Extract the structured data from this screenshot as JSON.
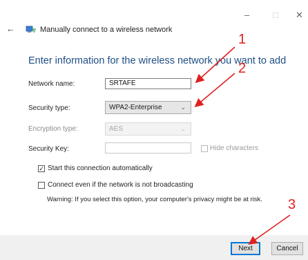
{
  "window": {
    "minimize_glyph": "–",
    "maximize_glyph": "□",
    "close_glyph": "✕",
    "back_glyph": "←",
    "title": "Manually connect to a wireless network"
  },
  "heading": "Enter information for the wireless network you want to add",
  "form": {
    "network_name_label": "Network name:",
    "network_name_value": "SRTAFE",
    "security_type_label": "Security type:",
    "security_type_value": "WPA2-Enterprise",
    "encryption_type_label": "Encryption type:",
    "encryption_type_value": "AES",
    "security_key_label": "Security Key:",
    "security_key_value": "",
    "hide_characters_label": "Hide characters",
    "hide_characters_checked": false,
    "chevron_glyph": "⌄"
  },
  "options": {
    "start_automatically_label": "Start this connection automatically",
    "start_automatically_checked": true,
    "connect_not_broadcasting_label": "Connect even if the network is not broadcasting",
    "connect_not_broadcasting_checked": false,
    "checkmark_glyph": "✓",
    "warning": "Warning: If you select this option, your computer's privacy might be at risk."
  },
  "footer": {
    "next_label": "Next",
    "cancel_label": "Cancel"
  },
  "annotations": {
    "label_1": "1",
    "label_2": "2",
    "label_3": "3",
    "color": "#e02020"
  },
  "icons": {
    "back": "back-arrow-icon",
    "network": "wireless-network-icon"
  }
}
